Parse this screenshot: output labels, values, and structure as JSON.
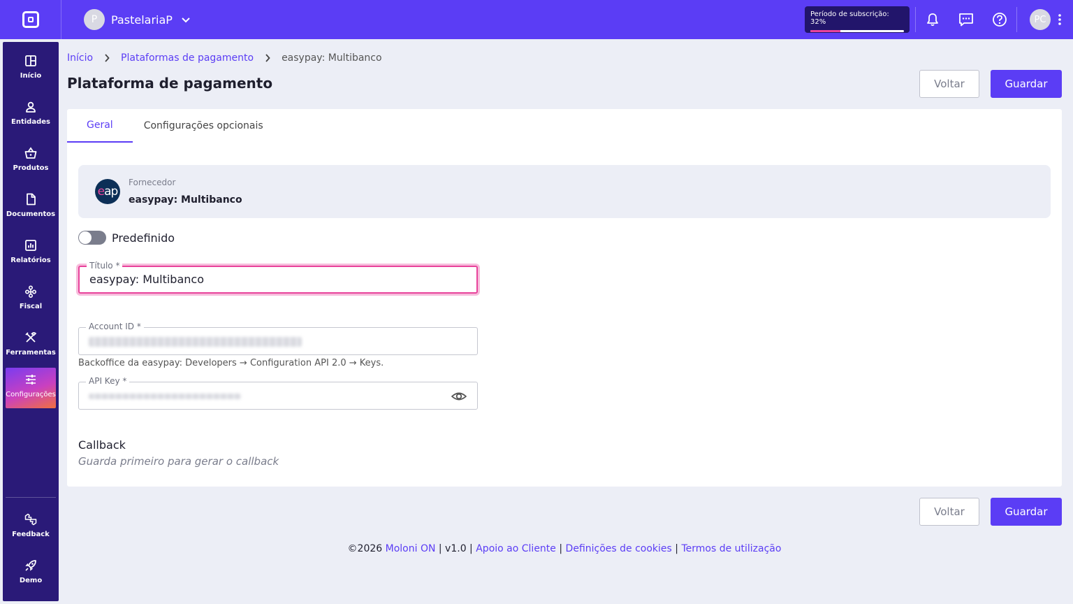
{
  "topbar": {
    "company_initial": "P",
    "company_name": "PastelariaP",
    "subscription_label": "Período de subscrição: 32%",
    "subscription_progress": 0.32,
    "user_initials": "PC"
  },
  "sidebar": {
    "items": [
      {
        "label": "Início",
        "icon": "grid-icon"
      },
      {
        "label": "Entidades",
        "icon": "person-icon"
      },
      {
        "label": "Produtos",
        "icon": "basket-icon"
      },
      {
        "label": "Documentos",
        "icon": "document-icon"
      },
      {
        "label": "Relatórios",
        "icon": "chart-icon"
      },
      {
        "label": "Fiscal",
        "icon": "hierarchy-icon"
      },
      {
        "label": "Ferramentas",
        "icon": "tools-icon"
      },
      {
        "label": "Configurações",
        "icon": "sliders-icon"
      }
    ],
    "bottom": [
      {
        "label": "Feedback",
        "icon": "feedback-icon"
      },
      {
        "label": "Demo",
        "icon": "rocket-icon"
      }
    ]
  },
  "breadcrumb": {
    "home": "Início",
    "section": "Plataformas de pagamento",
    "current": "easypay: Multibanco"
  },
  "page": {
    "title": "Plataforma de pagamento",
    "back_label": "Voltar",
    "save_label": "Guardar"
  },
  "tabs": [
    "Geral",
    "Configurações opcionais"
  ],
  "supplier": {
    "label": "Fornecedor",
    "name": "easypay: Multibanco",
    "logo_e": "e",
    "logo_ap": "ap"
  },
  "default_toggle": {
    "label": "Predefinido",
    "on": false
  },
  "form": {
    "title_label": "Título *",
    "title_value": "easypay: Multibanco",
    "account_label": "Account ID *",
    "account_hint": "Backoffice da easypay: Developers → Configuration API 2.0 → Keys.",
    "apikey_label": "API Key *"
  },
  "callback": {
    "title": "Callback",
    "hint": "Guarda primeiro para gerar o callback"
  },
  "footer": {
    "copyright": "©2026",
    "brand": "Moloni ON",
    "version": "| v1.0 |",
    "support": "Apoio ao Cliente",
    "sep": "|",
    "cookies": "Definições de cookies",
    "terms": "Termos de utilização"
  },
  "colors": {
    "primary": "#5b3df5",
    "sidebar": "#2a1a78",
    "focus": "#e8439b"
  }
}
